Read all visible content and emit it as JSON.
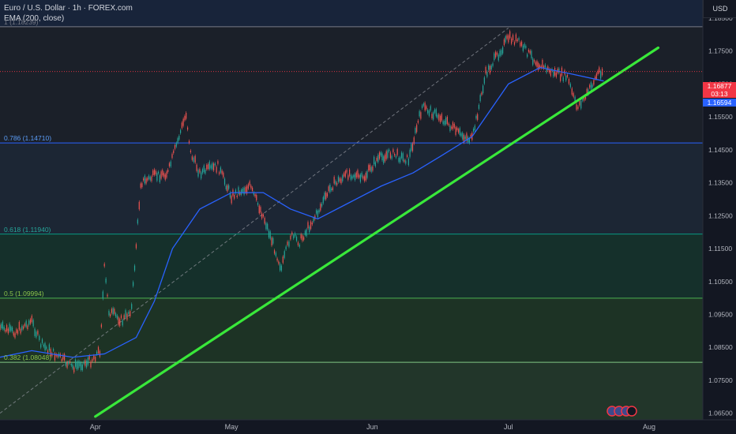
{
  "header": {
    "title": "Euro / U.S. Dollar · 1h · FOREX.com",
    "indicator": "EMA (200, close)"
  },
  "currency_button": "USD",
  "price_tags": {
    "last_price": "1.16877",
    "countdown": "03:13",
    "ema_value": "1.16594"
  },
  "fib_levels": [
    {
      "label": "1 (1.18239)",
      "price": 1.18239,
      "color": "#787b86"
    },
    {
      "label": "0.786 (1.14710)",
      "price": 1.1471,
      "color": "#2962ff"
    },
    {
      "label": "0.618 (1.11940)",
      "price": 1.1194,
      "color": "#089981"
    },
    {
      "label": "0.5 (1.09994)",
      "price": 1.09994,
      "color": "#4caf50"
    },
    {
      "label": "0.382 (1.08048)",
      "price": 1.08048,
      "color": "#81c784"
    }
  ],
  "chart_data": {
    "type": "line",
    "title": "Euro / U.S. Dollar · 1h · FOREX.com",
    "x_ticks": [
      "Apr",
      "May",
      "Jun",
      "Jul",
      "Aug"
    ],
    "y_ticks": [
      "1.18500",
      "1.17500",
      "1.16500",
      "1.15500",
      "1.14500",
      "1.13500",
      "1.12500",
      "1.11500",
      "1.10500",
      "1.09500",
      "1.08500",
      "1.07500",
      "1.06500"
    ],
    "ylim": [
      1.063,
      1.1905
    ],
    "last_price": 1.16877,
    "ema_last": 1.16594,
    "series": [
      {
        "name": "EURUSD",
        "color": "#d1d4dc",
        "points": [
          [
            "Mar 11",
            1.091
          ],
          [
            "Mar 14",
            1.0895
          ],
          [
            "Mar 18",
            1.093
          ],
          [
            "Mar 20",
            1.086
          ],
          [
            "Mar 24",
            1.082
          ],
          [
            "Mar 27",
            1.079
          ],
          [
            "Mar 31",
            1.081
          ],
          [
            "Apr 2",
            1.084
          ],
          [
            "Apr 3",
            1.109
          ],
          [
            "Apr 4",
            1.096
          ],
          [
            "Apr 7",
            1.093
          ],
          [
            "Apr 9",
            1.097
          ],
          [
            "Apr 11",
            1.135
          ],
          [
            "Apr 14",
            1.137
          ],
          [
            "Apr 17",
            1.138
          ],
          [
            "Apr 21",
            1.156
          ],
          [
            "Apr 22",
            1.144
          ],
          [
            "Apr 24",
            1.138
          ],
          [
            "Apr 28",
            1.14
          ],
          [
            "May 1",
            1.131
          ],
          [
            "May 5",
            1.134
          ],
          [
            "May 8",
            1.125
          ],
          [
            "May 12",
            1.109
          ],
          [
            "May 14",
            1.119
          ],
          [
            "May 16",
            1.117
          ],
          [
            "May 20",
            1.126
          ],
          [
            "May 23",
            1.134
          ],
          [
            "May 27",
            1.138
          ],
          [
            "May 30",
            1.136
          ],
          [
            "Jun 2",
            1.142
          ],
          [
            "Jun 5",
            1.144
          ],
          [
            "Jun 9",
            1.142
          ],
          [
            "Jun 12",
            1.158
          ],
          [
            "Jun 16",
            1.155
          ],
          [
            "Jun 20",
            1.15
          ],
          [
            "Jun 23",
            1.148
          ],
          [
            "Jun 26",
            1.168
          ],
          [
            "Jul 1",
            1.179
          ],
          [
            "Jul 3",
            1.178
          ],
          [
            "Jul 7",
            1.172
          ],
          [
            "Jul 10",
            1.169
          ],
          [
            "Jul 14",
            1.167
          ],
          [
            "Jul 16",
            1.158
          ],
          [
            "Jul 18",
            1.161
          ],
          [
            "Jul 21",
            1.169
          ],
          [
            "Jul 22",
            1.1688
          ]
        ]
      },
      {
        "name": "EMA (200, close)",
        "color": "#2962ff",
        "points": [
          [
            "Mar 11",
            1.082
          ],
          [
            "Mar 18",
            1.084
          ],
          [
            "Mar 27",
            1.082
          ],
          [
            "Apr 3",
            1.083
          ],
          [
            "Apr 10",
            1.088
          ],
          [
            "Apr 14",
            1.099
          ],
          [
            "Apr 18",
            1.115
          ],
          [
            "Apr 24",
            1.127
          ],
          [
            "May 1",
            1.132
          ],
          [
            "May 8",
            1.132
          ],
          [
            "May 14",
            1.127
          ],
          [
            "May 20",
            1.124
          ],
          [
            "May 27",
            1.129
          ],
          [
            "Jun 3",
            1.134
          ],
          [
            "Jun 10",
            1.138
          ],
          [
            "Jun 16",
            1.143
          ],
          [
            "Jun 23",
            1.149
          ],
          [
            "Jul 1",
            1.165
          ],
          [
            "Jul 8",
            1.17
          ],
          [
            "Jul 15",
            1.168
          ],
          [
            "Jul 22",
            1.1659
          ]
        ]
      }
    ],
    "annotations": [
      {
        "type": "trendline",
        "color": "#39e83a",
        "from": [
          "Apr 1",
          1.064
        ],
        "to": [
          "Aug 3",
          1.176
        ]
      },
      {
        "type": "dashed-line",
        "color": "#9598a1",
        "from": [
          "Mar 11",
          1.065
        ],
        "to": [
          "Jul 1",
          1.182
        ]
      }
    ]
  }
}
